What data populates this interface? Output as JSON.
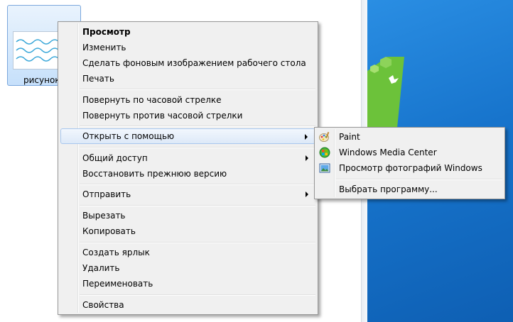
{
  "explorer": {
    "file": {
      "label": "рисунок"
    }
  },
  "context_menu": {
    "items": [
      {
        "label": "Просмотр"
      },
      {
        "label": "Изменить"
      },
      {
        "label": "Сделать фоновым изображением рабочего стола"
      },
      {
        "label": "Печать"
      },
      {
        "label": "Повернуть по часовой стрелке"
      },
      {
        "label": "Повернуть против часовой стрелки"
      },
      {
        "label": "Открыть с помощью"
      },
      {
        "label": "Общий доступ"
      },
      {
        "label": "Восстановить прежнюю версию"
      },
      {
        "label": "Отправить"
      },
      {
        "label": "Вырезать"
      },
      {
        "label": "Копировать"
      },
      {
        "label": "Создать ярлык"
      },
      {
        "label": "Удалить"
      },
      {
        "label": "Переименовать"
      },
      {
        "label": "Свойства"
      }
    ]
  },
  "open_with_submenu": {
    "items": [
      {
        "label": "Paint",
        "icon": "paint-icon"
      },
      {
        "label": "Windows Media Center",
        "icon": "windows-media-center-icon"
      },
      {
        "label": "Просмотр фотографий Windows",
        "icon": "photo-viewer-icon"
      },
      {
        "label": "Выбрать программу..."
      }
    ]
  },
  "colors": {
    "desktop_background": "#1774cc",
    "menu_background": "#f0f0f0",
    "highlight_border": "#a8c7ee"
  }
}
